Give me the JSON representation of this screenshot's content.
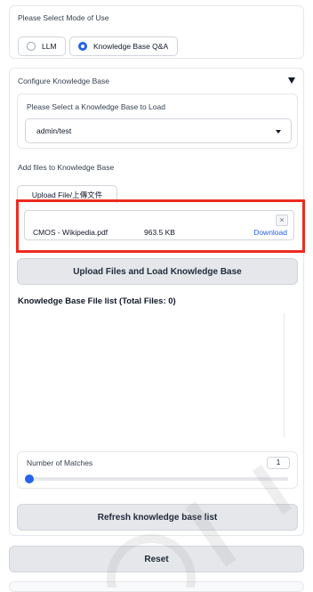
{
  "mode_section": {
    "label": "Please Select Mode of Use",
    "options": [
      "LLM",
      "Knowledge Base Q&A"
    ],
    "selected": "Knowledge Base Q&A"
  },
  "kb_section": {
    "header": "Configure Knowledge Base",
    "collapse_icon": "triangle-down-icon",
    "select_label": "Please Select a Knowledge Base to Load",
    "select_value": "admin/test",
    "add_files_label": "Add files to Knowledge Base",
    "upload_tab_label": "Upload File/上傳文件",
    "file": {
      "name": "CMOS - Wikipedia.pdf",
      "size": "963.5 KB",
      "download_label": "Download"
    },
    "upload_load_button": "Upload Files and Load Knowledge Base",
    "file_list_title": "Knowledge Base File list (Total Files: 0)",
    "matches_label": "Number of Matches",
    "matches_value": "1",
    "refresh_button": "Refresh knowledge base list"
  },
  "reset_button": "Reset",
  "colors": {
    "accent": "#2563eb",
    "highlight": "#ef2b1f"
  }
}
